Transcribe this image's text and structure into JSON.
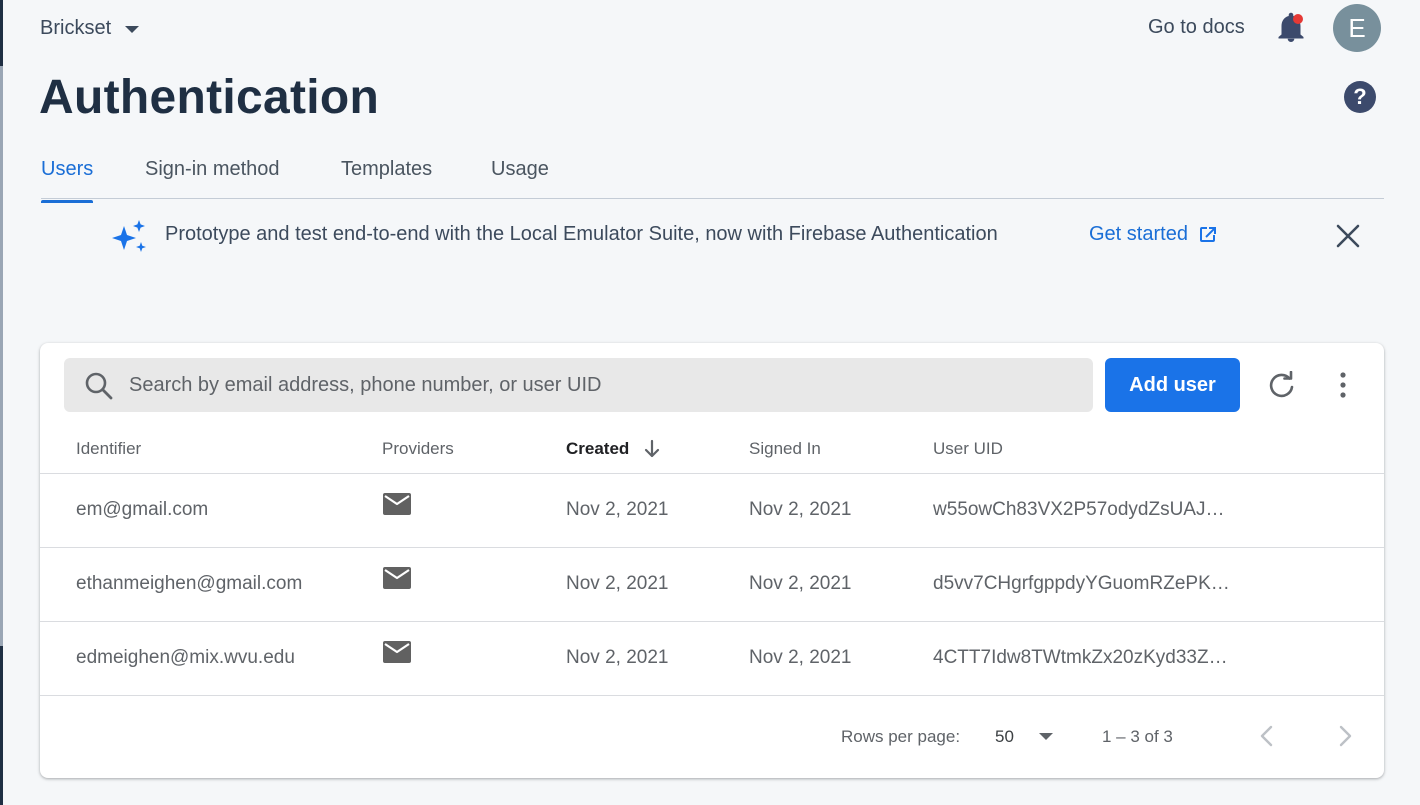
{
  "header": {
    "project_name": "Brickset",
    "go_to_docs": "Go to docs",
    "avatar_initial": "E"
  },
  "page": {
    "title": "Authentication"
  },
  "tabs": [
    {
      "label": "Users",
      "active": true
    },
    {
      "label": "Sign-in method",
      "active": false
    },
    {
      "label": "Templates",
      "active": false
    },
    {
      "label": "Usage",
      "active": false
    }
  ],
  "banner": {
    "text": "Prototype and test end-to-end with the Local Emulator Suite, now with Firebase Authentication",
    "cta_label": "Get started"
  },
  "toolbar": {
    "search_placeholder": "Search by email address, phone number, or user UID",
    "add_user_label": "Add user"
  },
  "table": {
    "columns": [
      "Identifier",
      "Providers",
      "Created",
      "Signed In",
      "User UID"
    ],
    "sorted_column": "Created",
    "rows": [
      {
        "identifier": "em@gmail.com",
        "provider": "email-icon",
        "created": "Nov 2, 2021",
        "signed_in": "Nov 2, 2021",
        "uid": "w55owCh83VX2P57odydZsUAJ…"
      },
      {
        "identifier": "ethanmeighen@gmail.com",
        "provider": "email-icon",
        "created": "Nov 2, 2021",
        "signed_in": "Nov 2, 2021",
        "uid": "d5vv7CHgrfgppdyYGuomRZePK…"
      },
      {
        "identifier": "edmeighen@mix.wvu.edu",
        "provider": "email-icon",
        "created": "Nov 2, 2021",
        "signed_in": "Nov 2, 2021",
        "uid": "4CTT7Idw8TWtmkZx20zKyd33Z…"
      }
    ]
  },
  "pagination": {
    "rows_per_page_label": "Rows per page:",
    "rows_per_page_value": "50",
    "range_text": "1 – 3 of 3"
  },
  "colors": {
    "accent": "#1a73e8",
    "page_background": "#f5f7f9",
    "title": "#1f2f43",
    "notification_dot": "#e53935",
    "avatar": "#78909c"
  }
}
